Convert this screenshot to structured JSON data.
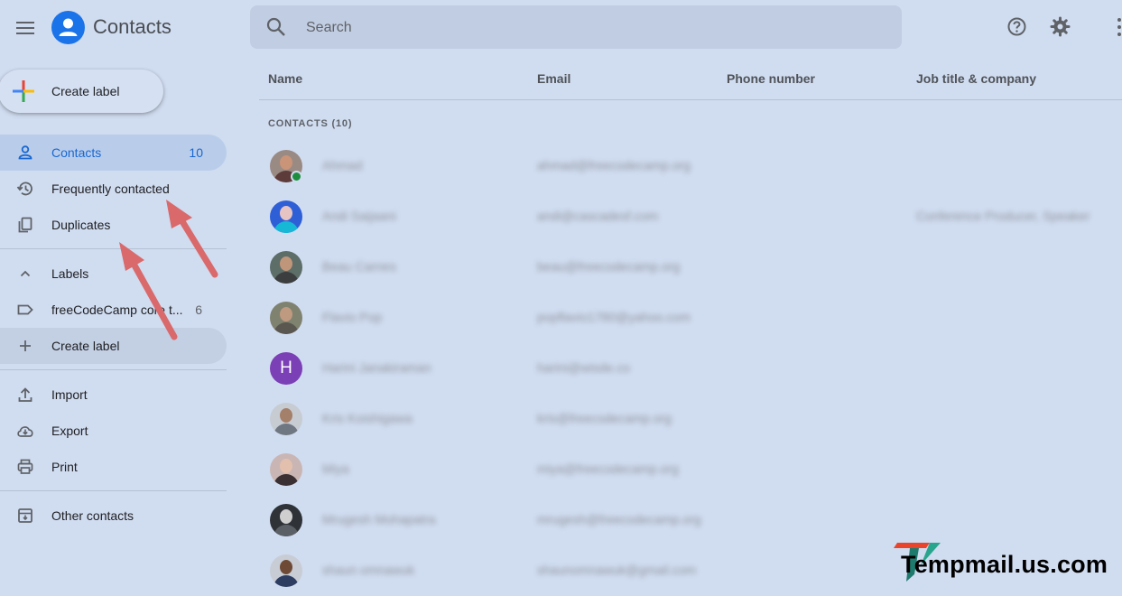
{
  "app": {
    "title": "Contacts"
  },
  "search": {
    "placeholder": "Search"
  },
  "sidebar": {
    "create_label": "Create label",
    "items": [
      {
        "label": "Contacts",
        "count": "10",
        "icon": "person-icon"
      },
      {
        "label": "Frequently contacted",
        "icon": "history-icon"
      },
      {
        "label": "Duplicates",
        "icon": "duplicate-icon"
      }
    ],
    "labels_header": "Labels",
    "label_items": [
      {
        "label": "freeCodeCamp core t...",
        "count": "6",
        "icon": "label-icon"
      }
    ],
    "actions": [
      {
        "label": "Import",
        "icon": "upload-icon"
      },
      {
        "label": "Export",
        "icon": "cloud-download-icon"
      },
      {
        "label": "Print",
        "icon": "print-icon"
      }
    ],
    "other_contacts": "Other contacts"
  },
  "table": {
    "columns": [
      "Name",
      "Email",
      "Phone number",
      "Job title & company"
    ],
    "section_label": "CONTACTS (10)",
    "rows": [
      {
        "name": "Ahmad",
        "email": "ahmad@freecodecamp.org",
        "phone": "",
        "job": ""
      },
      {
        "name": "Andi Saijaani",
        "email": "andi@cascadesf.com",
        "phone": "",
        "job": "Conference Producer, Speaker"
      },
      {
        "name": "Beau Carnes",
        "email": "beau@freecodecamp.org",
        "phone": "",
        "job": ""
      },
      {
        "name": "Flavio Pop",
        "email": "popflavio1780@yahoo.com",
        "phone": "",
        "job": ""
      },
      {
        "name": "Harini Janakiraman",
        "email": "harini@wisde.co",
        "phone": "",
        "job": "",
        "initial": "H"
      },
      {
        "name": "Kris Koishigawa",
        "email": "kris@freecodecamp.org",
        "phone": "",
        "job": ""
      },
      {
        "name": "Miya",
        "email": "miya@freecodecamp.org",
        "phone": "",
        "job": ""
      },
      {
        "name": "Mrugesh Mohapatra",
        "email": "mrugesh@freecodecamp.org",
        "phone": "",
        "job": ""
      },
      {
        "name": "shaun omnawuk",
        "email": "shaunomnawuk@gmail.com",
        "phone": "",
        "job": ""
      }
    ]
  },
  "watermark": {
    "text": "Tempmail.us.com"
  },
  "colors": {
    "accent": "#1a73e8",
    "background": "#d0dcf0",
    "annotation_arrow": "#d9696b"
  }
}
